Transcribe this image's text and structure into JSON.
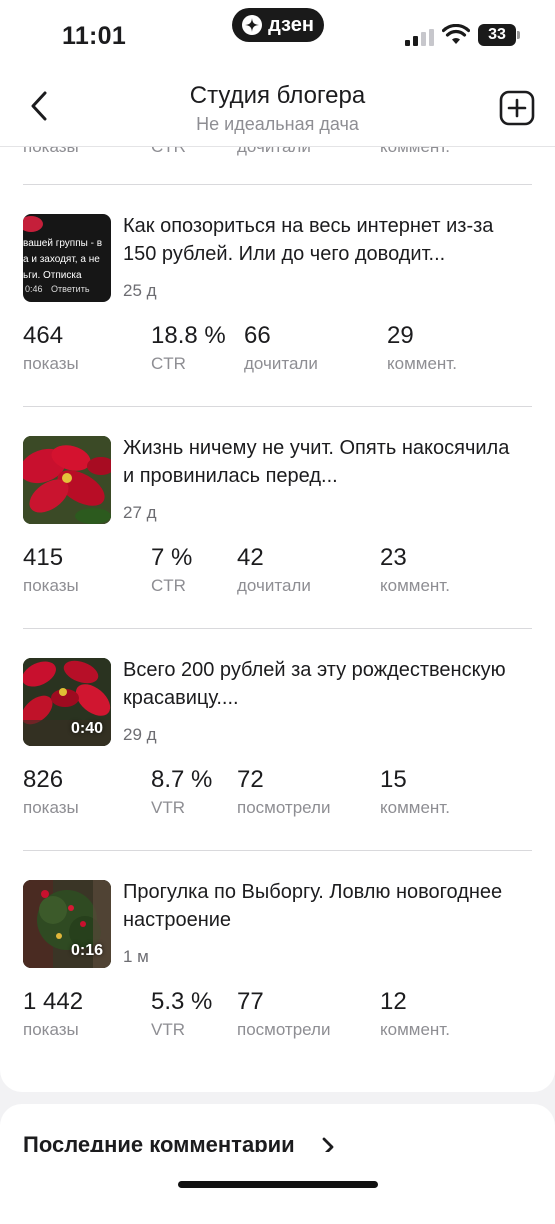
{
  "status_bar": {
    "time": "11:01",
    "center_badge": "дзен",
    "battery": "33"
  },
  "header": {
    "title": "Студия блогера",
    "subtitle": "Не идеальная дача"
  },
  "partial_row": {
    "labels": [
      "показы",
      "CTR",
      "дочитали",
      "коммент."
    ]
  },
  "posts": [
    {
      "title": "Как опозориться на весь интернет из-за 150 рублей. Или до чего доводит...",
      "age": "25 д",
      "thumb_lines": [
        "вашей группы - в",
        "а и заходят, а не",
        "ьги. Отписка"
      ],
      "thumb_footer_time": "0:46",
      "thumb_footer_action": "Ответить",
      "stats": [
        {
          "value": "464",
          "label": "показы"
        },
        {
          "value": "18.8 %",
          "label": "CTR"
        },
        {
          "value": "66",
          "label": "дочитали"
        },
        {
          "value": "29",
          "label": "коммент."
        }
      ]
    },
    {
      "title": "Жизнь ничему не учит. Опять накосячила и провинилась перед...",
      "age": "27 д",
      "stats": [
        {
          "value": "415",
          "label": "показы"
        },
        {
          "value": "7 %",
          "label": "CTR"
        },
        {
          "value": "42",
          "label": "дочитали"
        },
        {
          "value": "23",
          "label": "коммент."
        }
      ]
    },
    {
      "title": "Всего 200 рублей за эту рождественскую красавицу....",
      "age": "29 д",
      "duration": "0:40",
      "stats": [
        {
          "value": "826",
          "label": "показы"
        },
        {
          "value": "8.7 %",
          "label": "VTR"
        },
        {
          "value": "72",
          "label": "посмотрели"
        },
        {
          "value": "15",
          "label": "коммент."
        }
      ]
    },
    {
      "title": "Прогулка по Выборгу. Ловлю новогоднее настроение",
      "age": "1 м",
      "duration": "0:16",
      "stats": [
        {
          "value": "1 442",
          "label": "показы"
        },
        {
          "value": "5.3 %",
          "label": "VTR"
        },
        {
          "value": "77",
          "label": "посмотрели"
        },
        {
          "value": "12",
          "label": "коммент."
        }
      ]
    }
  ],
  "comments_section": {
    "title": "Последние комментарии"
  },
  "colors": {
    "label_gray": "#8e8e93",
    "divider": "#d9d9dc",
    "page_bg": "#f2f2f4"
  }
}
